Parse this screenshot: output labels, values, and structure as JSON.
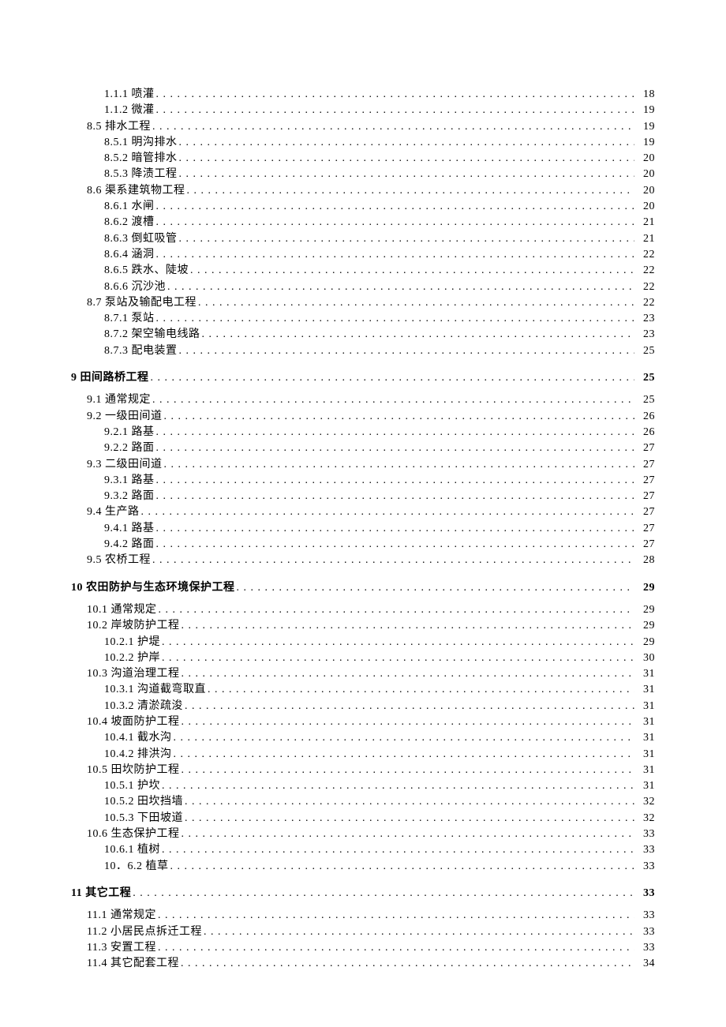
{
  "toc": [
    {
      "level": 2,
      "num": "1.1.1",
      "title": "喷灌",
      "page": "18"
    },
    {
      "level": 2,
      "num": "1.1.2",
      "title": "微灌",
      "page": "19"
    },
    {
      "level": 1,
      "num": "8.5",
      "title": "排水工程",
      "page": "19"
    },
    {
      "level": 2,
      "num": "8.5.1",
      "title": "明沟排水",
      "page": "19"
    },
    {
      "level": 2,
      "num": "8.5.2",
      "title": "暗管排水",
      "page": "20"
    },
    {
      "level": 2,
      "num": "8.5.3",
      "title": "降渍工程",
      "page": "20"
    },
    {
      "level": 1,
      "num": "8.6",
      "title": "渠系建筑物工程",
      "page": "20"
    },
    {
      "level": 2,
      "num": "8.6.1",
      "title": "水闸",
      "page": "20"
    },
    {
      "level": 2,
      "num": "8.6.2",
      "title": "渡槽",
      "page": "21"
    },
    {
      "level": 2,
      "num": "8.6.3",
      "title": "倒虹吸管",
      "page": "21"
    },
    {
      "level": 2,
      "num": "8.6.4",
      "title": "涵洞",
      "page": "22"
    },
    {
      "level": 2,
      "num": "8.6.5",
      "title": "跌水、陡坡",
      "page": "22"
    },
    {
      "level": 2,
      "num": "8.6.6",
      "title": "沉沙池",
      "page": "22"
    },
    {
      "level": 1,
      "num": "8.7",
      "title": "泵站及输配电工程",
      "page": "22"
    },
    {
      "level": 2,
      "num": "8.7.1",
      "title": "泵站",
      "page": "23"
    },
    {
      "level": 2,
      "num": "8.7.2",
      "title": "架空输电线路",
      "page": "23"
    },
    {
      "level": 2,
      "num": "8.7.3",
      "title": "配电装置",
      "page": "25"
    },
    {
      "level": 0,
      "num": "9",
      "title": "田间路桥工程",
      "page": "25"
    },
    {
      "level": 1,
      "num": "9.1",
      "title": "通常规定",
      "page": "25"
    },
    {
      "level": 1,
      "num": "9.2",
      "title": "一级田间道",
      "page": "26"
    },
    {
      "level": 2,
      "num": "9.2.1",
      "title": "路基",
      "page": "26"
    },
    {
      "level": 2,
      "num": "9.2.2",
      "title": "路面",
      "page": "27"
    },
    {
      "level": 1,
      "num": "9.3",
      "title": "二级田间道",
      "page": "27"
    },
    {
      "level": 2,
      "num": "9.3.1",
      "title": "路基",
      "page": "27"
    },
    {
      "level": 2,
      "num": "9.3.2",
      "title": "路面",
      "page": "27"
    },
    {
      "level": 1,
      "num": "9.4",
      "title": "生产路",
      "page": "27"
    },
    {
      "level": 2,
      "num": "9.4.1",
      "title": "路基",
      "page": "27"
    },
    {
      "level": 2,
      "num": "9.4.2",
      "title": "路面",
      "page": "27"
    },
    {
      "level": 1,
      "num": "9.5",
      "title": "农桥工程",
      "page": "28"
    },
    {
      "level": 0,
      "num": "10",
      "title": "农田防护与生态环境保护工程",
      "page": "29"
    },
    {
      "level": 1,
      "num": "10.1",
      "title": "通常规定",
      "page": "29"
    },
    {
      "level": 1,
      "num": "10.2",
      "title": "岸坡防护工程",
      "page": "29"
    },
    {
      "level": 2,
      "num": "10.2.1",
      "title": "护堤",
      "page": "29"
    },
    {
      "level": 2,
      "num": "10.2.2",
      "title": "护岸",
      "page": "30"
    },
    {
      "level": 1,
      "num": "10.3",
      "title": "沟道治理工程",
      "page": "31"
    },
    {
      "level": 2,
      "num": "10.3.1",
      "title": "沟道截弯取直",
      "page": "31"
    },
    {
      "level": 2,
      "num": "10.3.2",
      "title": "清淤疏浚",
      "page": "31"
    },
    {
      "level": 1,
      "num": "10.4",
      "title": "坡面防护工程",
      "page": "31"
    },
    {
      "level": 2,
      "num": "10.4.1",
      "title": "截水沟",
      "page": "31"
    },
    {
      "level": 2,
      "num": "10.4.2",
      "title": "排洪沟",
      "page": "31"
    },
    {
      "level": 1,
      "num": "10.5",
      "title": "田坎防护工程",
      "page": "31"
    },
    {
      "level": 2,
      "num": "10.5.1",
      "title": "护坎",
      "page": "31"
    },
    {
      "level": 2,
      "num": "10.5.2",
      "title": "田坎挡墙",
      "page": "32"
    },
    {
      "level": 2,
      "num": "10.5.3",
      "title": "下田坡道",
      "page": "32"
    },
    {
      "level": 1,
      "num": "10.6",
      "title": "生态保护工程",
      "page": "33"
    },
    {
      "level": 2,
      "num": "10.6.1",
      "title": "植树",
      "page": "33"
    },
    {
      "level": 2,
      "num": "10．6.2",
      "title": "植草",
      "page": "33"
    },
    {
      "level": 0,
      "num": "11",
      "title": "其它工程",
      "page": "33"
    },
    {
      "level": 1,
      "num": "11.1",
      "title": "通常规定",
      "page": "33"
    },
    {
      "level": 1,
      "num": "11.2",
      "title": "小居民点拆迁工程",
      "page": "33"
    },
    {
      "level": 1,
      "num": "11.3",
      "title": "安置工程",
      "page": "33"
    },
    {
      "level": 1,
      "num": "11.4",
      "title": "其它配套工程",
      "page": "34"
    }
  ]
}
